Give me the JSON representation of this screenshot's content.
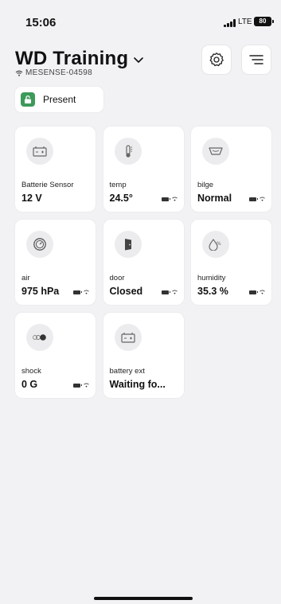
{
  "status_bar": {
    "time": "15:06",
    "network": "LTE",
    "battery": "80"
  },
  "header": {
    "title": "WD Training",
    "device_id": "MESENSE-04598"
  },
  "presence": {
    "label": "Present",
    "color": "#3d9a5b"
  },
  "sensors": [
    {
      "name": "Batterie Sensor",
      "value": "12 V",
      "icon": "battery-icon",
      "show_status": false
    },
    {
      "name": "temp",
      "value": "24.5°",
      "icon": "thermometer-icon",
      "show_status": true
    },
    {
      "name": "bilge",
      "value": "Normal",
      "icon": "bilge-icon",
      "show_status": true
    },
    {
      "name": "air",
      "value": "975 hPa",
      "icon": "gauge-icon",
      "show_status": true
    },
    {
      "name": "door",
      "value": "Closed",
      "icon": "door-icon",
      "show_status": true
    },
    {
      "name": "humidity",
      "value": "35.3 %",
      "icon": "humidity-icon",
      "show_status": true
    },
    {
      "name": "shock",
      "value": "0 G",
      "icon": "shock-icon",
      "show_status": true
    },
    {
      "name": "battery ext",
      "value": "Waiting fo...",
      "icon": "battery-icon",
      "show_status": false
    }
  ]
}
